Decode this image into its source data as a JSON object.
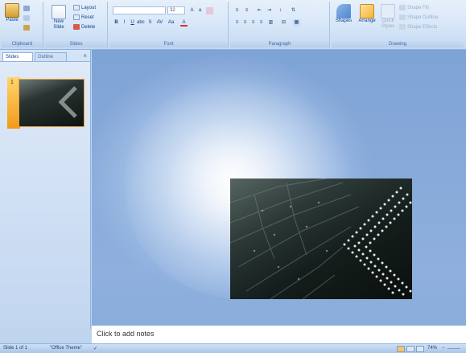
{
  "ribbon": {
    "clipboard": {
      "label": "Clipboard",
      "paste": "Paste"
    },
    "slides": {
      "label": "Slides",
      "new_slide": "New Slide",
      "layout": "Layout",
      "reset": "Reset",
      "delete": "Delete"
    },
    "font": {
      "label": "Font",
      "font_name": "",
      "font_size": "32"
    },
    "paragraph": {
      "label": "Paragraph"
    },
    "drawing": {
      "label": "Drawing",
      "shapes": "Shapes",
      "arrange": "Arrange",
      "quick_styles": "Quick Styles",
      "shape_fill": "Shape Fill",
      "shape_outline": "Shape Outline",
      "shape_effects": "Shape Effects"
    }
  },
  "left_panel": {
    "tabs": [
      {
        "label": "Slides"
      },
      {
        "label": "Outline"
      }
    ],
    "close": "×",
    "thumbnails": [
      {
        "number": "1"
      }
    ]
  },
  "notes": {
    "placeholder": "Click to add notes"
  },
  "status_bar": {
    "slide_info": "Slide 1 of 1",
    "theme": "\"Office Theme\"",
    "zoom": "74%"
  },
  "colors": {
    "accent": "#f29a1a",
    "ribbon": "#d6e6f8",
    "panel": "#c2d6f0"
  }
}
